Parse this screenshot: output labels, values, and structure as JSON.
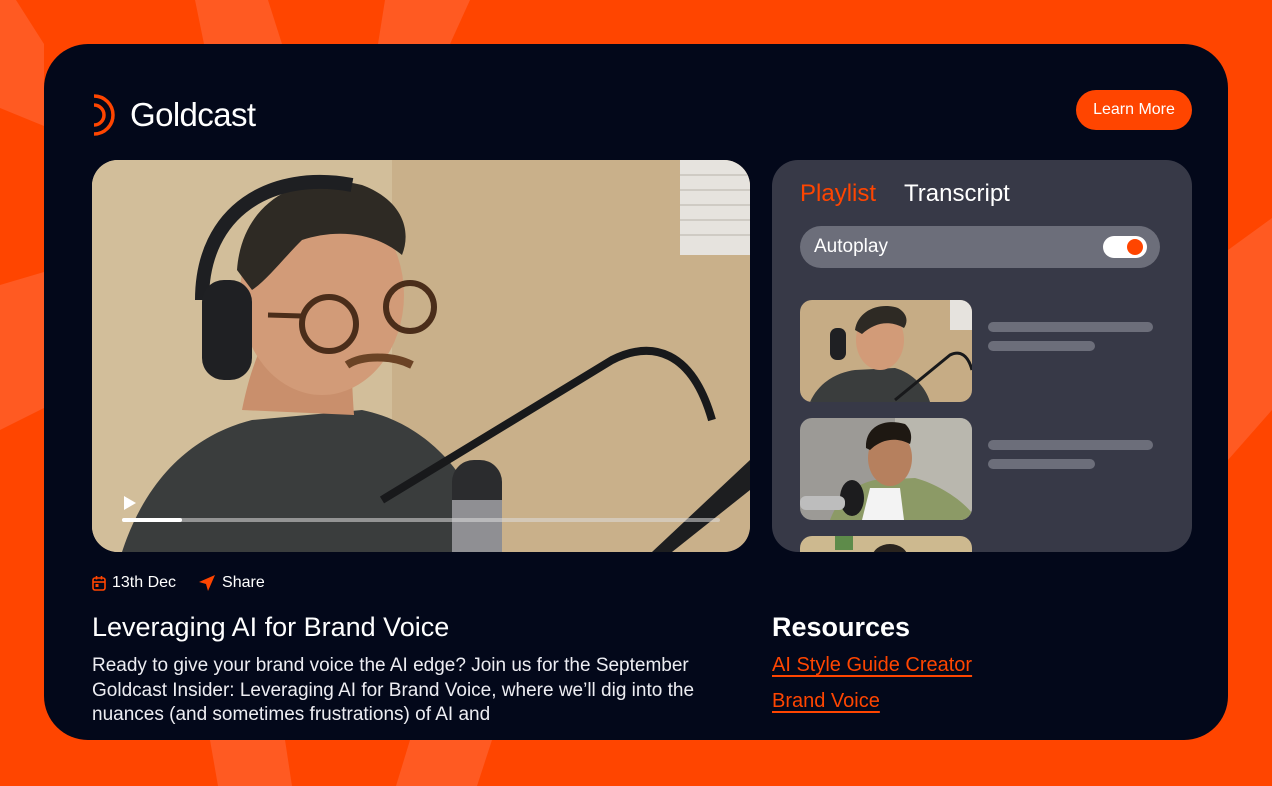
{
  "brand": {
    "name": "Goldcast",
    "accent_color": "#FF4500",
    "card_color": "#03081A",
    "panel_color": "#373947"
  },
  "header": {
    "cta_label": "Learn More"
  },
  "video": {
    "play_icon": "play-icon",
    "progress_percent": 10
  },
  "sidebar": {
    "tabs": [
      {
        "label": "Playlist",
        "active": true
      },
      {
        "label": "Transcript",
        "active": false
      }
    ],
    "autoplay": {
      "label": "Autoplay",
      "enabled": true
    },
    "playlist_items": [
      {
        "thumbnail": "man-with-headphones-podcast"
      },
      {
        "thumbnail": "man-with-glasses-microphone"
      },
      {
        "thumbnail": "partially-visible-item"
      }
    ]
  },
  "event": {
    "date_icon": "calendar-icon",
    "date": "13th Dec",
    "share_icon": "send-arrow-icon",
    "share_label": "Share",
    "title": "Leveraging AI for Brand Voice",
    "description": "Ready to give your brand voice the AI edge? Join us for the September Goldcast Insider: Leveraging AI for Brand Voice, where we’ll dig into the nuances (and sometimes frustrations) of AI and"
  },
  "resources": {
    "title": "Resources",
    "links": [
      {
        "label": "AI Style Guide Creator"
      },
      {
        "label": "Brand Voice"
      }
    ]
  }
}
